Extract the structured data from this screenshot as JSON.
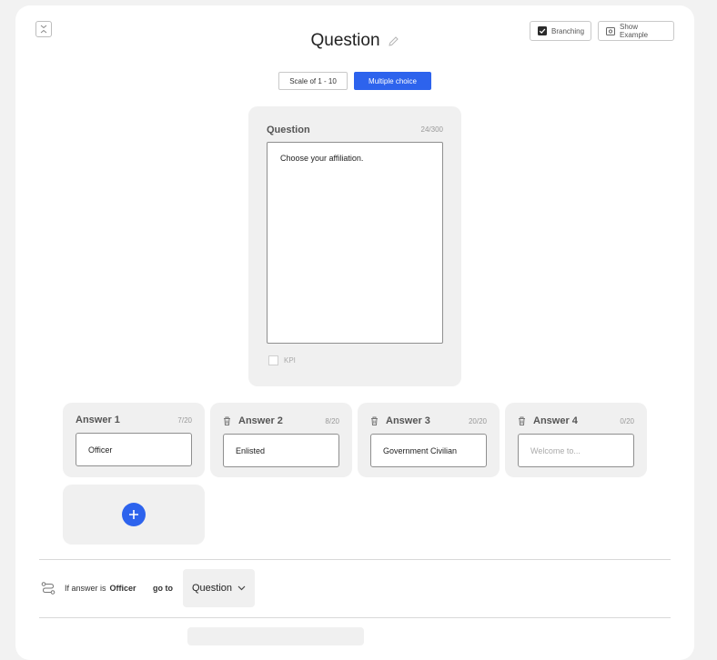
{
  "toolbar": {
    "branching_label": "Branching",
    "branching_checked": true,
    "show_example_label": "Show Example"
  },
  "header": {
    "title": "Question"
  },
  "question_type": {
    "options": [
      "Scale of 1 - 10",
      "Multiple choice"
    ],
    "selected": "Multiple choice"
  },
  "question": {
    "label": "Question",
    "count": "24/300",
    "text": "Choose your affiliation.",
    "kpi_label": "KPI",
    "kpi_checked": false
  },
  "answers": [
    {
      "label": "Answer 1",
      "count": "7/20",
      "value": "Officer",
      "placeholder": ""
    },
    {
      "label": "Answer 2",
      "count": "8/20",
      "value": "Enlisted",
      "placeholder": ""
    },
    {
      "label": "Answer 3",
      "count": "20/20",
      "value": "Government Civilian",
      "placeholder": ""
    },
    {
      "label": "Answer 4",
      "count": "0/20",
      "value": "",
      "placeholder": "Welcome to..."
    }
  ],
  "branching": {
    "prefix": "If answer is",
    "answer": "Officer",
    "goto": "go to",
    "destination": "Question"
  },
  "colors": {
    "accent": "#2d63ed",
    "panel": "#f0f0f0",
    "background": "#f2f2f2"
  }
}
